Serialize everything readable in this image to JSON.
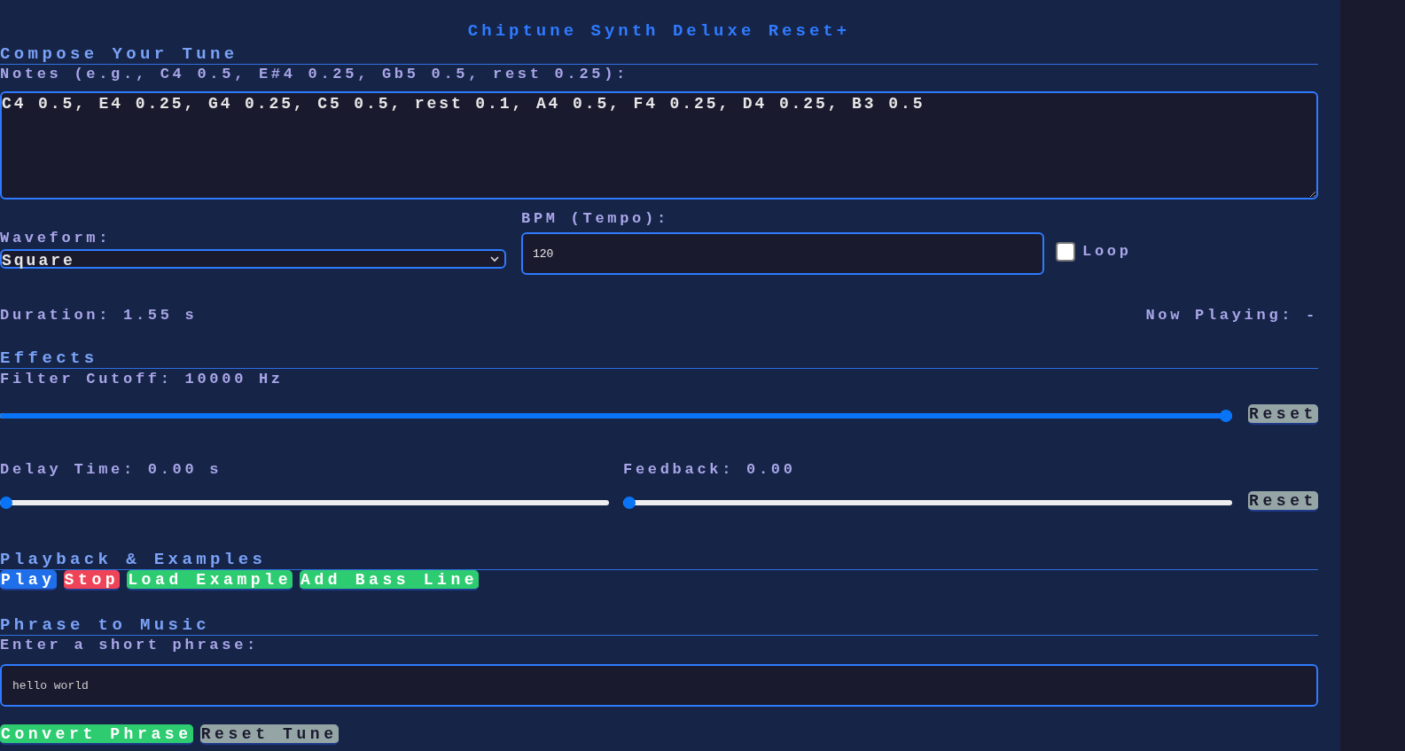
{
  "title": "Chiptune Synth Deluxe Reset+",
  "compose": {
    "heading": "Compose Your Tune",
    "notes_label": "Notes (e.g., C4 0.5, E#4 0.25, Gb5 0.5, rest 0.25):",
    "notes_value": "C4 0.5, E4 0.25, G4 0.25, C5 0.5, rest 0.1, A4 0.5, F4 0.25, D4 0.25, B3 0.5",
    "waveform_label": "Waveform:",
    "waveform_value": "Square",
    "bpm_label": "BPM (Tempo):",
    "bpm_value": "120",
    "loop": {
      "label": "Loop",
      "checked": false
    },
    "duration": "Duration: 1.55 s",
    "now_playing": "Now Playing: -"
  },
  "effects": {
    "heading": "Effects",
    "rows": [
      {
        "sliders": [
          {
            "label": "Filter Cutoff: 10000 Hz",
            "level": 1.0
          }
        ],
        "reset": "Reset"
      },
      {
        "sliders": [
          {
            "label": "Delay Time: 0.00 s",
            "level": 0.0
          },
          {
            "label": "Feedback: 0.00",
            "level": 0.0
          }
        ],
        "reset": "Reset"
      }
    ]
  },
  "playback": {
    "heading": "Playback & Examples",
    "buttons": [
      {
        "label": "Play",
        "kind": "primary"
      },
      {
        "label": "Stop",
        "kind": "danger"
      },
      {
        "label": "Load Example",
        "kind": "success"
      },
      {
        "label": "Add Bass Line",
        "kind": "success"
      }
    ]
  },
  "phrase": {
    "heading": "Phrase to Music",
    "label": "Enter a short phrase:",
    "value": "hello world",
    "buttons": [
      {
        "label": "Convert Phrase",
        "kind": "success"
      },
      {
        "label": "Reset Tune",
        "kind": "neutral"
      }
    ]
  }
}
